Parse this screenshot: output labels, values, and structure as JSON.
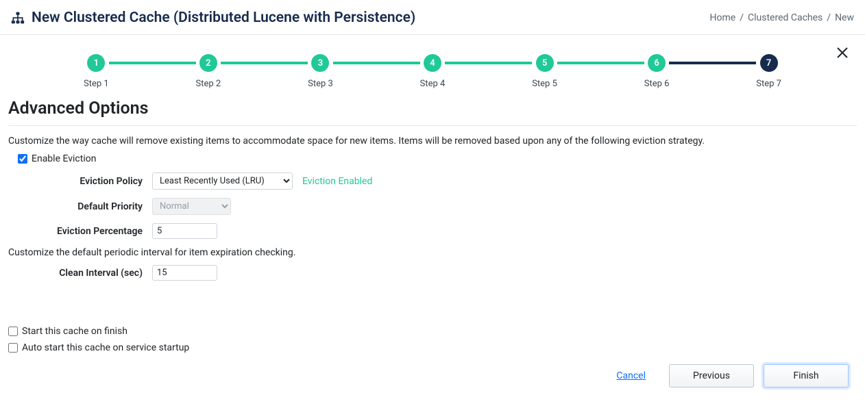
{
  "header": {
    "title": "New Clustered Cache (Distributed Lucene with Persistence)"
  },
  "breadcrumb": {
    "home": "Home",
    "mid": "Clustered Caches",
    "current": "New"
  },
  "stepper": {
    "steps": [
      {
        "num": "1",
        "label": "Step 1",
        "state": "done"
      },
      {
        "num": "2",
        "label": "Step 2",
        "state": "done"
      },
      {
        "num": "3",
        "label": "Step 3",
        "state": "done"
      },
      {
        "num": "4",
        "label": "Step 4",
        "state": "done"
      },
      {
        "num": "5",
        "label": "Step 5",
        "state": "done"
      },
      {
        "num": "6",
        "label": "Step 6",
        "state": "done"
      },
      {
        "num": "7",
        "label": "Step 7",
        "state": "current"
      }
    ]
  },
  "section": {
    "title": "Advanced Options",
    "desc_eviction": "Customize the way cache will remove existing items to accommodate space for new items. Items will be removed based upon any of the following eviction strategy.",
    "enable_eviction_label": "Enable Eviction",
    "eviction_policy_label": "Eviction Policy",
    "eviction_policy_value": "Least Recently Used (LRU)",
    "eviction_status": "Eviction Enabled",
    "default_priority_label": "Default Priority",
    "default_priority_value": "Normal",
    "eviction_percentage_label": "Eviction Percentage",
    "eviction_percentage_value": "5",
    "desc_interval": "Customize the default periodic interval for item expiration checking.",
    "clean_interval_label": "Clean Interval (sec)",
    "clean_interval_value": "15",
    "start_on_finish_label": "Start this cache on finish",
    "auto_start_label": "Auto start this cache on service startup"
  },
  "footer": {
    "cancel": "Cancel",
    "previous": "Previous",
    "finish": "Finish"
  }
}
